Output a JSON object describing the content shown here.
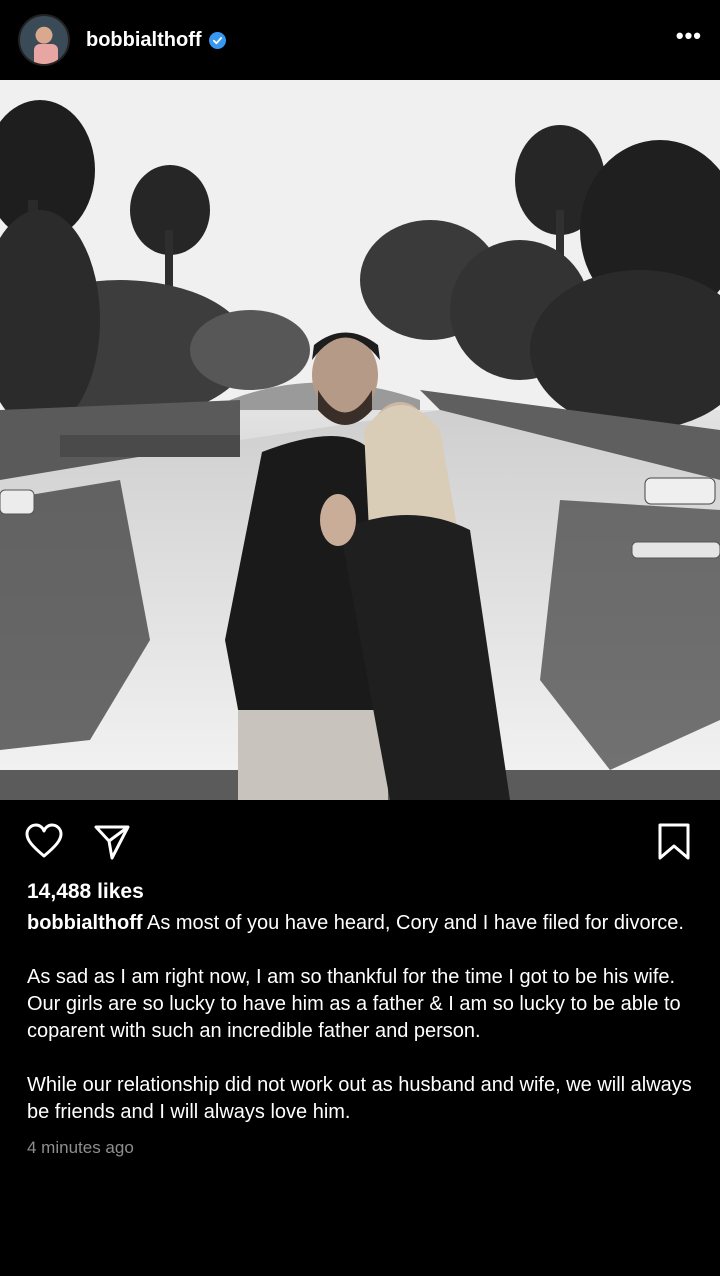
{
  "header": {
    "username": "bobbialthoff",
    "verified": true,
    "more_icon": "ellipsis-icon"
  },
  "post": {
    "photo_icon": "photo",
    "likes": "14,488 likes",
    "caption_user": "bobbialthoff",
    "caption_first": " As most of you have heard, Cory and I have filed for divorce.",
    "caption_second": "As sad as I am right now, I am so thankful for the time I got to be his wife. Our girls are so lucky to have him as a father & I am so lucky to be able to coparent with such an incredible father and person.",
    "caption_third": "While our relationship did not work out as husband and wife, we will always be friends and I will always love him.",
    "timestamp": "4 minutes ago"
  },
  "actions": {
    "like_icon": "heart-icon",
    "share_icon": "paper-plane-icon",
    "save_icon": "bookmark-icon"
  },
  "colors": {
    "background": "#000000",
    "text": "#ffffff",
    "muted": "#8e8e8e",
    "verified": "#3897f0"
  }
}
